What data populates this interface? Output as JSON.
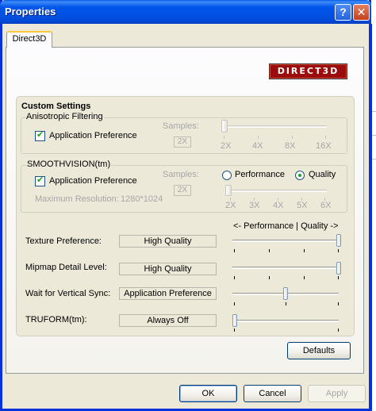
{
  "window": {
    "title": "Properties"
  },
  "titlebar": {
    "help_glyph": "?",
    "close_glyph": "✕"
  },
  "tabs": [
    {
      "label": "Direct3D"
    }
  ],
  "logo": {
    "text": "DIRECT3D"
  },
  "custom_settings": {
    "title": "Custom Settings",
    "anisotropic": {
      "title": "Anisotropic Filtering",
      "checkbox_label": "Application Preference",
      "checked": true,
      "samples_label": "Samples:",
      "samples_value": "2X",
      "tick_labels": [
        "2X",
        "4X",
        "8X",
        "16X"
      ]
    },
    "smoothvision": {
      "title": "SMOOTHVISION(tm)",
      "checkbox_label": "Application Preference",
      "checked": true,
      "max_res_label": "Maximum Resolution:",
      "max_res_value": "1280*1024",
      "samples_label": "Samples:",
      "samples_value": "2X",
      "radio_performance": "Performance",
      "radio_quality": "Quality",
      "selected": "Quality",
      "tick_labels": [
        "2X",
        "3X",
        "4X",
        "5X",
        "6X"
      ]
    },
    "scale_header": "<- Performance  |  Quality ->",
    "rows": [
      {
        "label": "Texture Preference:",
        "value": "High Quality"
      },
      {
        "label": "Mipmap Detail Level:",
        "value": "High Quality"
      },
      {
        "label": "Wait for Vertical Sync:",
        "value": "Application Preference"
      },
      {
        "label": "TRUFORM(tm):",
        "value": "Always Off"
      }
    ],
    "defaults_button": "Defaults"
  },
  "buttons": {
    "ok": "OK",
    "cancel": "Cancel",
    "apply": "Apply"
  }
}
